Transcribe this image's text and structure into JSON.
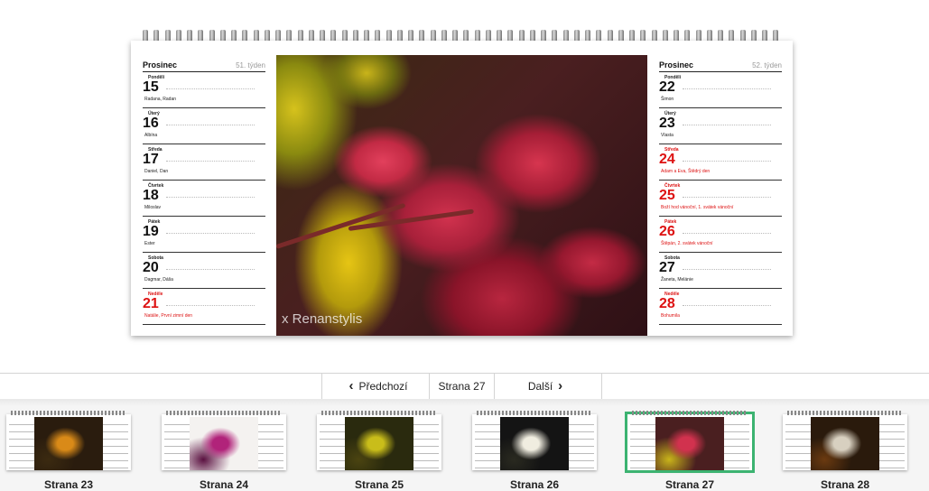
{
  "calendar": {
    "left_week": {
      "month": "Prosinec",
      "week": "51. týden",
      "days": [
        {
          "name": "Pondělí",
          "num": "15",
          "names": "Radana, Radan",
          "holiday": false
        },
        {
          "name": "Úterý",
          "num": "16",
          "names": "Albína",
          "holiday": false
        },
        {
          "name": "Středa",
          "num": "17",
          "names": "Daniel, Dan",
          "holiday": false
        },
        {
          "name": "Čtvrtek",
          "num": "18",
          "names": "Miloslav",
          "holiday": false
        },
        {
          "name": "Pátek",
          "num": "19",
          "names": "Ester",
          "holiday": false
        },
        {
          "name": "Sobota",
          "num": "20",
          "names": "Dagmar, Dáša",
          "holiday": false
        },
        {
          "name": "Neděle",
          "num": "21",
          "names": "Natálie, První zimní den",
          "holiday": true
        }
      ]
    },
    "right_week": {
      "month": "Prosinec",
      "week": "52. týden",
      "days": [
        {
          "name": "Pondělí",
          "num": "22",
          "names": "Šimon",
          "holiday": false
        },
        {
          "name": "Úterý",
          "num": "23",
          "names": "Vlasta",
          "holiday": false
        },
        {
          "name": "Středa",
          "num": "24",
          "names": "Adam a Eva, Štědrý den",
          "holiday": true
        },
        {
          "name": "Čtvrtek",
          "num": "25",
          "names": "Boží hod vánoční, 1. svátek vánoční",
          "holiday": true
        },
        {
          "name": "Pátek",
          "num": "26",
          "names": "Štěpán, 2. svátek vánoční",
          "holiday": true
        },
        {
          "name": "Sobota",
          "num": "27",
          "names": "Žaneta, Melánie",
          "holiday": false
        },
        {
          "name": "Neděle",
          "num": "28",
          "names": "Bohumila",
          "holiday": true
        }
      ]
    },
    "photo_credit": "x Renanstylis"
  },
  "nav": {
    "prev_label": "Předchozí",
    "page_label": "Strana 27",
    "next_label": "Další",
    "prev_icon": "chevron-left-icon",
    "next_icon": "chevron-right-icon"
  },
  "thumbnails": [
    {
      "label": "Strana 23",
      "active": false,
      "colors": [
        "#2a1c0e",
        "#d98a18",
        "#3b2a10"
      ]
    },
    {
      "label": "Strana 24",
      "active": false,
      "colors": [
        "#f4f2f0",
        "#b1237a",
        "#5a1040"
      ]
    },
    {
      "label": "Strana 25",
      "active": false,
      "colors": [
        "#2a2a0e",
        "#c9bd1a",
        "#4b4410"
      ]
    },
    {
      "label": "Strana 26",
      "active": false,
      "colors": [
        "#141414",
        "#f0ede0",
        "#2a2a20"
      ]
    },
    {
      "label": "Strana 27",
      "active": true,
      "colors": [
        "#4a1f20",
        "#d1324e",
        "#c9b41a"
      ]
    },
    {
      "label": "Strana 28",
      "active": false,
      "colors": [
        "#2a1a0c",
        "#d8d0c0",
        "#6b3a10"
      ]
    }
  ]
}
